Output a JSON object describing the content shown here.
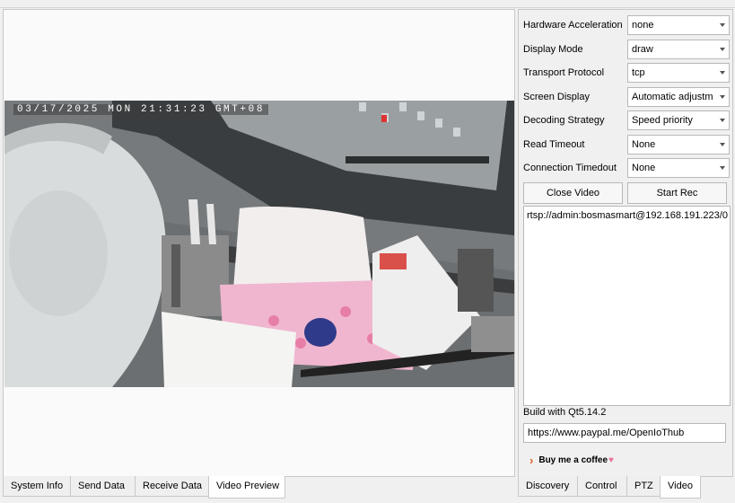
{
  "video": {
    "osd_text": "03/17/2025 MON 21:31:23 GMT+08"
  },
  "left_tabs": [
    {
      "label": "System Info"
    },
    {
      "label": "Send Data"
    },
    {
      "label": "Receive Data"
    },
    {
      "label": "Video Preview"
    }
  ],
  "settings": [
    {
      "label": "Hardware Acceleration",
      "value": "none"
    },
    {
      "label": "Display Mode",
      "value": "draw"
    },
    {
      "label": "Transport Protocol",
      "value": "tcp"
    },
    {
      "label": "Screen Display",
      "value": "Automatic adjustm"
    },
    {
      "label": "Decoding Strategy",
      "value": "Speed priority"
    },
    {
      "label": "Read Timeout",
      "value": "None"
    },
    {
      "label": "Connection Timedout",
      "value": "None"
    }
  ],
  "buttons": {
    "close_video": "Close Video",
    "start_rec": "Start Rec"
  },
  "url_list": "rtsp://admin:bosmasmart@192.168.191.223/0",
  "build_info": "Build with Qt5.14.2",
  "paypal_url": "https://www.paypal.me/OpenIoThub",
  "coffee": {
    "label": "Buy me a coffee",
    "heart": "♥"
  },
  "right_tabs": [
    {
      "label": "Discovery"
    },
    {
      "label": "Control"
    },
    {
      "label": "PTZ"
    },
    {
      "label": "Video"
    }
  ]
}
